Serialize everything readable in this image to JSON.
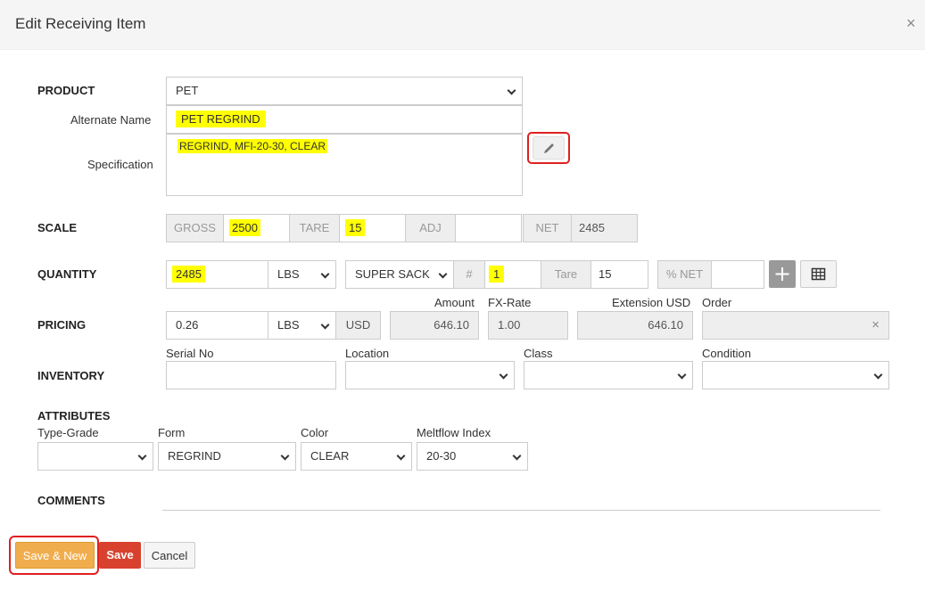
{
  "dialog": {
    "title": "Edit Receiving Item",
    "close_label": "×"
  },
  "product": {
    "label": "PRODUCT",
    "value": "PET",
    "alt_name_label": "Alternate Name",
    "alt_name_value": "PET REGRIND",
    "spec_label": "Specification",
    "spec_value": "REGRIND, MFI-20-30, CLEAR",
    "edit_icon": "pencil-icon"
  },
  "scale": {
    "label": "SCALE",
    "gross_label": "GROSS",
    "gross_value": "2500",
    "tare_label": "TARE",
    "tare_value": "15",
    "adj_label": "ADJ",
    "adj_value": "",
    "net_label": "NET",
    "net_value": "2485"
  },
  "quantity": {
    "label": "QUANTITY",
    "value": "2485",
    "unit": "LBS",
    "container": "SUPER SACK",
    "count_label": "#",
    "count_value": "1",
    "tare_label": "Tare",
    "tare_value": "15",
    "pct_net_label": "% NET",
    "pct_net_value": "",
    "add_icon": "plus-icon",
    "grid_icon": "grid-icon"
  },
  "pricing": {
    "label": "PRICING",
    "price": "0.26",
    "unit": "LBS",
    "currency": "USD",
    "amount_label": "Amount",
    "amount_value": "646.10",
    "fx_label": "FX-Rate",
    "fx_value": "1.00",
    "extension_label": "Extension USD",
    "extension_value": "646.10",
    "order_label": "Order",
    "order_value": "",
    "order_clear": "×"
  },
  "inventory": {
    "label": "INVENTORY",
    "serial_label": "Serial No",
    "serial_value": "",
    "location_label": "Location",
    "location_value": "",
    "class_label": "Class",
    "class_value": "",
    "condition_label": "Condition",
    "condition_value": ""
  },
  "attributes": {
    "label": "ATTRIBUTES",
    "type_grade_label": "Type-Grade",
    "type_grade_value": "",
    "form_label": "Form",
    "form_value": "REGRIND",
    "color_label": "Color",
    "color_value": "CLEAR",
    "meltflow_label": "Meltflow Index",
    "meltflow_value": "20-30"
  },
  "comments": {
    "label": "COMMENTS"
  },
  "buttons": {
    "save_new": "Save & New",
    "save": "Save",
    "cancel": "Cancel"
  },
  "colors": {
    "highlight": "#ffff00",
    "save_new": "#f0ad4e",
    "save": "#d9412f",
    "focus_ring": "#e02020"
  }
}
